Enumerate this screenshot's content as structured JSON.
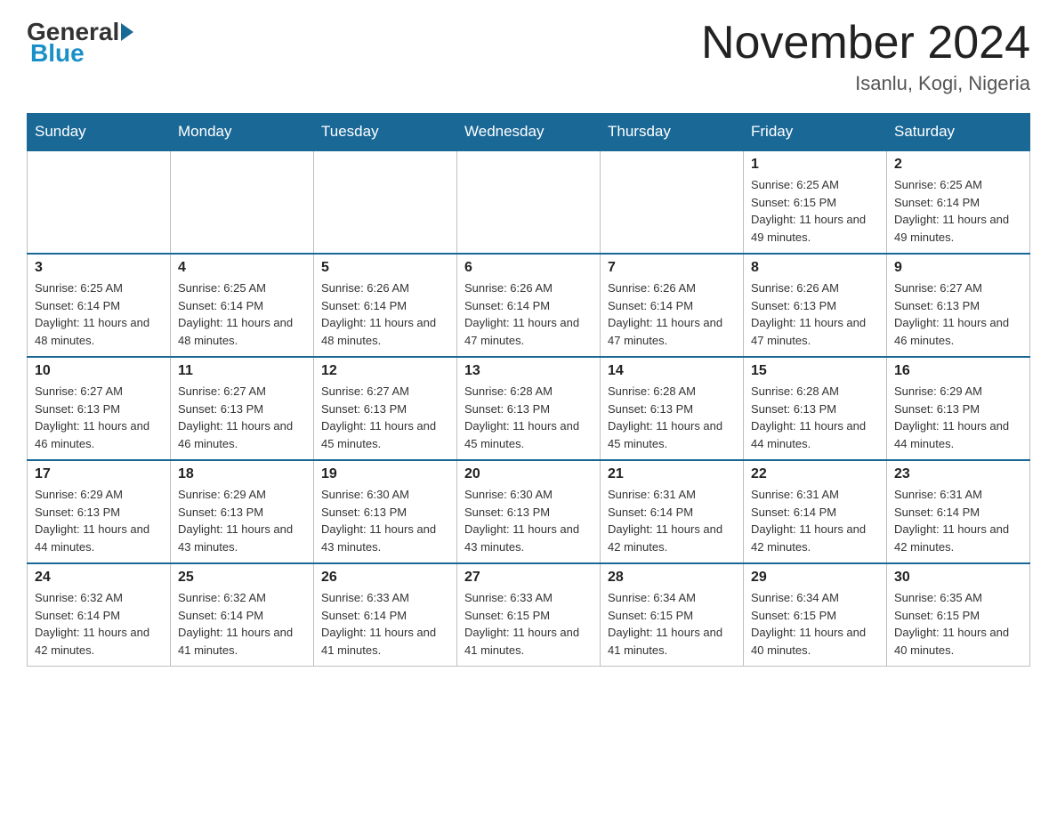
{
  "logo": {
    "general": "General",
    "blue": "Blue"
  },
  "title": "November 2024",
  "subtitle": "Isanlu, Kogi, Nigeria",
  "days_of_week": [
    "Sunday",
    "Monday",
    "Tuesday",
    "Wednesday",
    "Thursday",
    "Friday",
    "Saturday"
  ],
  "weeks": [
    [
      {
        "day": "",
        "info": ""
      },
      {
        "day": "",
        "info": ""
      },
      {
        "day": "",
        "info": ""
      },
      {
        "day": "",
        "info": ""
      },
      {
        "day": "",
        "info": ""
      },
      {
        "day": "1",
        "info": "Sunrise: 6:25 AM\nSunset: 6:15 PM\nDaylight: 11 hours and 49 minutes."
      },
      {
        "day": "2",
        "info": "Sunrise: 6:25 AM\nSunset: 6:14 PM\nDaylight: 11 hours and 49 minutes."
      }
    ],
    [
      {
        "day": "3",
        "info": "Sunrise: 6:25 AM\nSunset: 6:14 PM\nDaylight: 11 hours and 48 minutes."
      },
      {
        "day": "4",
        "info": "Sunrise: 6:25 AM\nSunset: 6:14 PM\nDaylight: 11 hours and 48 minutes."
      },
      {
        "day": "5",
        "info": "Sunrise: 6:26 AM\nSunset: 6:14 PM\nDaylight: 11 hours and 48 minutes."
      },
      {
        "day": "6",
        "info": "Sunrise: 6:26 AM\nSunset: 6:14 PM\nDaylight: 11 hours and 47 minutes."
      },
      {
        "day": "7",
        "info": "Sunrise: 6:26 AM\nSunset: 6:14 PM\nDaylight: 11 hours and 47 minutes."
      },
      {
        "day": "8",
        "info": "Sunrise: 6:26 AM\nSunset: 6:13 PM\nDaylight: 11 hours and 47 minutes."
      },
      {
        "day": "9",
        "info": "Sunrise: 6:27 AM\nSunset: 6:13 PM\nDaylight: 11 hours and 46 minutes."
      }
    ],
    [
      {
        "day": "10",
        "info": "Sunrise: 6:27 AM\nSunset: 6:13 PM\nDaylight: 11 hours and 46 minutes."
      },
      {
        "day": "11",
        "info": "Sunrise: 6:27 AM\nSunset: 6:13 PM\nDaylight: 11 hours and 46 minutes."
      },
      {
        "day": "12",
        "info": "Sunrise: 6:27 AM\nSunset: 6:13 PM\nDaylight: 11 hours and 45 minutes."
      },
      {
        "day": "13",
        "info": "Sunrise: 6:28 AM\nSunset: 6:13 PM\nDaylight: 11 hours and 45 minutes."
      },
      {
        "day": "14",
        "info": "Sunrise: 6:28 AM\nSunset: 6:13 PM\nDaylight: 11 hours and 45 minutes."
      },
      {
        "day": "15",
        "info": "Sunrise: 6:28 AM\nSunset: 6:13 PM\nDaylight: 11 hours and 44 minutes."
      },
      {
        "day": "16",
        "info": "Sunrise: 6:29 AM\nSunset: 6:13 PM\nDaylight: 11 hours and 44 minutes."
      }
    ],
    [
      {
        "day": "17",
        "info": "Sunrise: 6:29 AM\nSunset: 6:13 PM\nDaylight: 11 hours and 44 minutes."
      },
      {
        "day": "18",
        "info": "Sunrise: 6:29 AM\nSunset: 6:13 PM\nDaylight: 11 hours and 43 minutes."
      },
      {
        "day": "19",
        "info": "Sunrise: 6:30 AM\nSunset: 6:13 PM\nDaylight: 11 hours and 43 minutes."
      },
      {
        "day": "20",
        "info": "Sunrise: 6:30 AM\nSunset: 6:13 PM\nDaylight: 11 hours and 43 minutes."
      },
      {
        "day": "21",
        "info": "Sunrise: 6:31 AM\nSunset: 6:14 PM\nDaylight: 11 hours and 42 minutes."
      },
      {
        "day": "22",
        "info": "Sunrise: 6:31 AM\nSunset: 6:14 PM\nDaylight: 11 hours and 42 minutes."
      },
      {
        "day": "23",
        "info": "Sunrise: 6:31 AM\nSunset: 6:14 PM\nDaylight: 11 hours and 42 minutes."
      }
    ],
    [
      {
        "day": "24",
        "info": "Sunrise: 6:32 AM\nSunset: 6:14 PM\nDaylight: 11 hours and 42 minutes."
      },
      {
        "day": "25",
        "info": "Sunrise: 6:32 AM\nSunset: 6:14 PM\nDaylight: 11 hours and 41 minutes."
      },
      {
        "day": "26",
        "info": "Sunrise: 6:33 AM\nSunset: 6:14 PM\nDaylight: 11 hours and 41 minutes."
      },
      {
        "day": "27",
        "info": "Sunrise: 6:33 AM\nSunset: 6:15 PM\nDaylight: 11 hours and 41 minutes."
      },
      {
        "day": "28",
        "info": "Sunrise: 6:34 AM\nSunset: 6:15 PM\nDaylight: 11 hours and 41 minutes."
      },
      {
        "day": "29",
        "info": "Sunrise: 6:34 AM\nSunset: 6:15 PM\nDaylight: 11 hours and 40 minutes."
      },
      {
        "day": "30",
        "info": "Sunrise: 6:35 AM\nSunset: 6:15 PM\nDaylight: 11 hours and 40 minutes."
      }
    ]
  ]
}
